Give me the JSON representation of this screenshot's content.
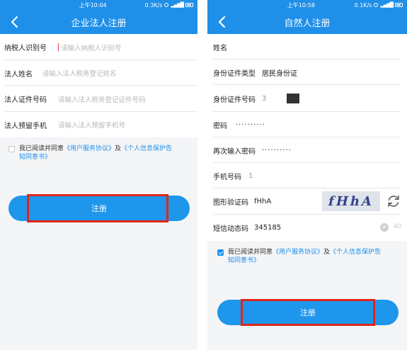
{
  "left": {
    "status": {
      "time": "上午10:04",
      "rate": "0.3K/s"
    },
    "title": "企业法人注册",
    "fields": [
      {
        "label": "纳税人识别号",
        "placeholder": "请输入纳税人识别号"
      },
      {
        "label": "法人姓名",
        "placeholder": "请输入法人税务登记姓名"
      },
      {
        "label": "法人证件号码",
        "placeholder": "请输入法人税务登记证件号码"
      },
      {
        "label": "法人预留手机",
        "placeholder": "请输入法人预留手机号"
      }
    ],
    "agree": {
      "prefix": "我已阅读并同意",
      "link1": "《用户服务协议》",
      "and": "及",
      "link2a": "《个人信息保护告",
      "link2b": "知同意书》",
      "checked": false
    },
    "register_label": "注册"
  },
  "right": {
    "status": {
      "time": "上午10:58",
      "rate": "0.1K/s"
    },
    "title": "自然人注册",
    "fields": {
      "name": {
        "label": "姓名"
      },
      "id_type": {
        "label": "身份证件类型",
        "value": "居民身份证"
      },
      "id_number": {
        "label": "身份证件号码",
        "value": "3"
      },
      "password": {
        "label": "密码",
        "value": "··········"
      },
      "password_confirm": {
        "label": "再次输入密码",
        "value": "··········"
      },
      "phone": {
        "label": "手机号码",
        "value": "1"
      },
      "captcha": {
        "label": "图形验证码",
        "value": "fHhA",
        "image_text": "fHhA"
      },
      "sms": {
        "label": "短信动态码",
        "value": "345185",
        "countdown": "40"
      }
    },
    "agree": {
      "prefix": "我已阅读并同意",
      "link1": "《用户服务协议》",
      "and": "及",
      "link2a": "《个人信息保护告",
      "link2b": "知同意书》",
      "checked": true
    },
    "register_label": "注册"
  },
  "colors": {
    "primary": "#1f8fe8",
    "highlight": "#e0261b"
  },
  "icons": {
    "back": "chevron-left-icon",
    "refresh": "refresh-icon",
    "clear": "clear-circle-icon"
  }
}
